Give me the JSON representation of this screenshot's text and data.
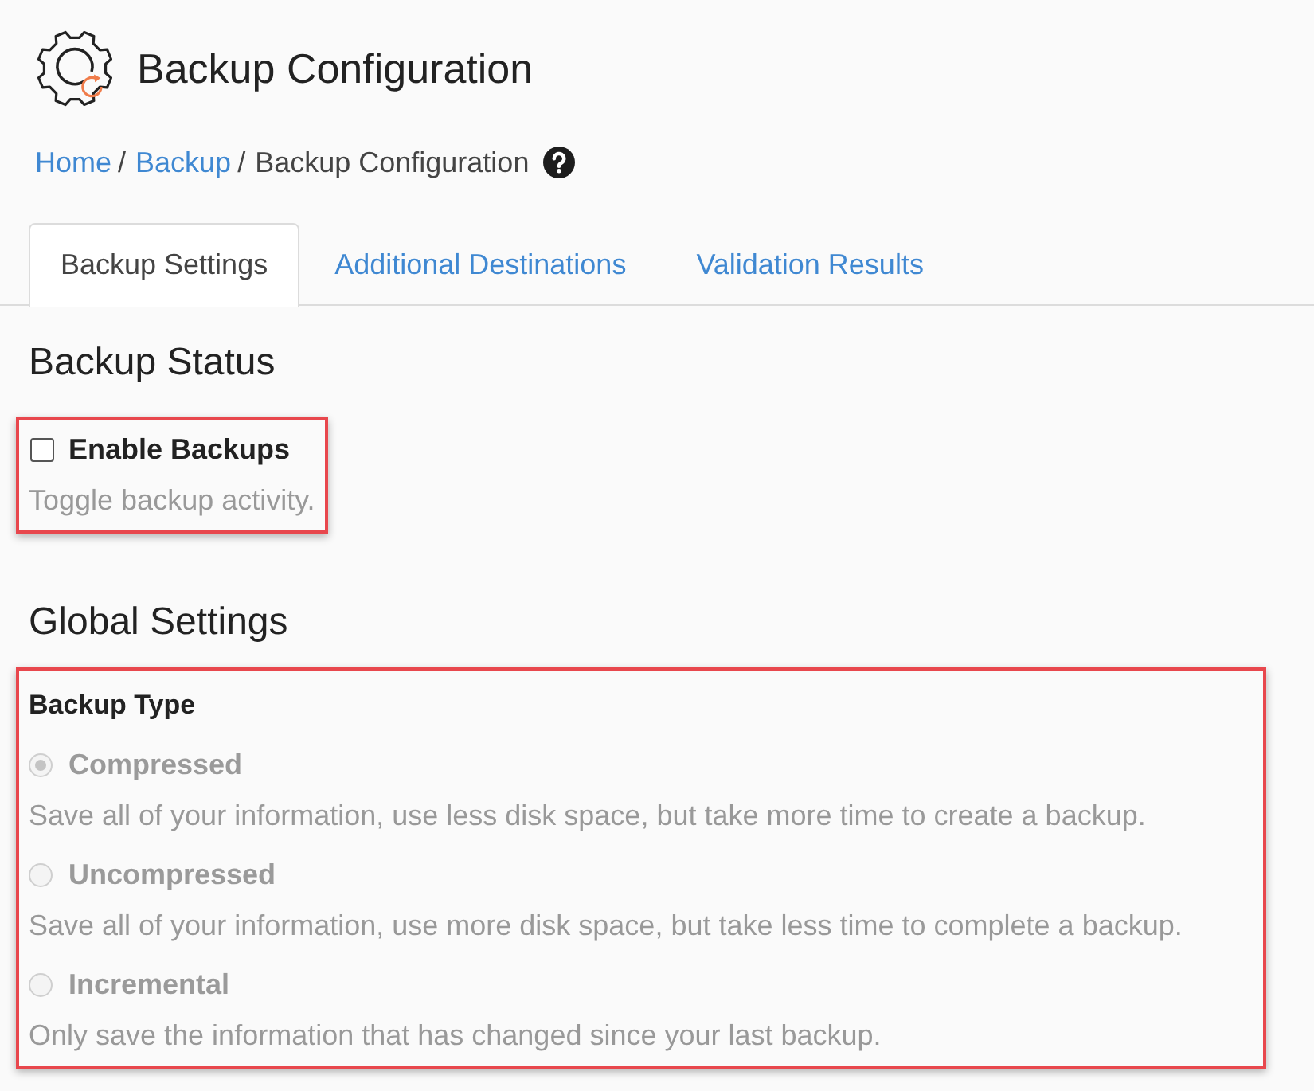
{
  "page": {
    "title": "Backup Configuration"
  },
  "breadcrumb": [
    {
      "label": "Home",
      "kind": "link",
      "separator": "/"
    },
    {
      "label": "Backup",
      "kind": "link",
      "separator": "/"
    },
    {
      "label": "Backup Configuration",
      "kind": "current"
    }
  ],
  "tabs": [
    {
      "label": "Backup Settings",
      "selected": true
    },
    {
      "label": "Additional Destinations",
      "selected": false
    },
    {
      "label": "Validation Results",
      "selected": false
    }
  ],
  "backup_status": {
    "heading": "Backup Status",
    "checkbox": {
      "label": "Enable Backups",
      "checked": false,
      "description": "Toggle backup activity.",
      "highlighted": true
    }
  },
  "global_settings": {
    "heading": "Global Settings",
    "backup_type": {
      "label": "Backup Type",
      "highlighted": true,
      "options": [
        {
          "label": "Compressed",
          "selected": true,
          "disabled": true,
          "description": "Save all of your information, use less disk space, but take more time to create a backup."
        },
        {
          "label": "Uncompressed",
          "selected": false,
          "disabled": true,
          "description": "Save all of your information, use more disk space, but take less time to complete a backup."
        },
        {
          "label": "Incremental",
          "selected": false,
          "disabled": true,
          "description": "Only save the information that has changed since your last backup."
        }
      ]
    }
  }
}
